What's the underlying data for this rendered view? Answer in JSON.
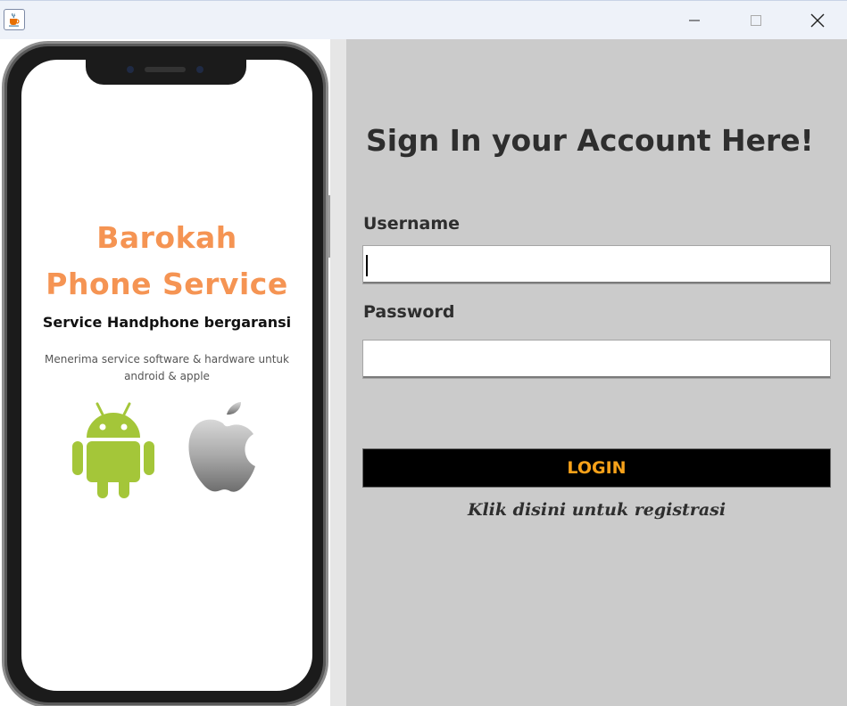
{
  "window": {
    "app_icon": "java-cup-icon",
    "controls": {
      "minimize_icon": "minimize-icon",
      "maximize_icon": "maximize-icon",
      "close_icon": "close-icon"
    }
  },
  "promo": {
    "brand_line1": "Barokah",
    "brand_line2": "Phone Service",
    "tagline": "Service Handphone bergaransi",
    "description_line1": "Menerima service software & hardware untuk",
    "description_line2": "android & apple",
    "logos": [
      "android-icon",
      "apple-icon"
    ],
    "brand_color": "#f59453"
  },
  "form": {
    "heading": "Sign In your Account Here!",
    "username_label": "Username",
    "username_value": "",
    "password_label": "Password",
    "password_value": "",
    "login_label": "LOGIN",
    "register_link": "Klik disini untuk registrasi",
    "panel_color": "#cbcbcb",
    "button_text_color": "#f8a21a"
  }
}
